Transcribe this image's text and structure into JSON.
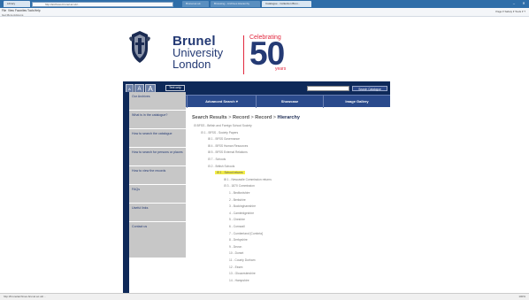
{
  "browser": {
    "tabs": [
      {
        "label": "Library",
        "active": true
      },
      {
        "label": "Brunel.ac.uk",
        "active": false
      },
      {
        "label": "Browsing - Archives Hierarchy",
        "active": false
      },
      {
        "label": "Catalogue - Collection Brun...",
        "active": false
      }
    ],
    "address": "http://archives.brunel.ac.uk/...",
    "menu": [
      "File",
      "View",
      "Favorites",
      "Tools",
      "Help"
    ],
    "favorites_bar": "Get More Add-ons",
    "command_bar": "Page ▾  Safety ▾  Tools ▾  ?"
  },
  "site": {
    "brand_word1": "Brunel",
    "brand_word2": "University",
    "brand_word3": "London",
    "celebrating": "Celebrating",
    "fifty": "50",
    "years": "years",
    "font_sizes": [
      "A",
      "A",
      "A"
    ],
    "text_only": "Text only",
    "search_button": "Search Catalogue",
    "nav": [
      "Home",
      "Advanced Search",
      "Showcase",
      "Image Gallery"
    ],
    "sidebar": [
      "Our Archives",
      "What is in the catalogue?",
      "How to search the catalogue",
      "How to search for persons or places",
      "How to view the records",
      "FAQs",
      "Useful links",
      "Contact us"
    ],
    "breadcrumb": {
      "a": "Search Results",
      "b": "Record",
      "c": "Record",
      "d": "Hierarchy",
      "sep": ">"
    },
    "tree": [
      {
        "text": "⊟ BFSS - British and Foreign School Society",
        "level": 0
      },
      {
        "text": "⊟ 1 - BFSS - Society Papers",
        "level": 1
      },
      {
        "text": "⊞ 1 - BFSS Governance",
        "level": 2
      },
      {
        "text": "⊞ 4 - BFSS Human Resources",
        "level": 2
      },
      {
        "text": "⊞ 5 - BFSS External Relations",
        "level": 2
      },
      {
        "text": "⊟ 7 - Schools",
        "level": 2
      },
      {
        "text": "⊟ 2 - British Schools",
        "level": 3
      },
      {
        "text": "⊟ 1 - School returns",
        "level": 4,
        "highlight": true
      },
      {
        "text": "⊞ 1 - Newcastle Commission returns",
        "level": 5
      },
      {
        "text": "⊟ 3 - 1870 Commission",
        "level": 5
      },
      {
        "text": "1 - Bedfordshire",
        "level": 6
      },
      {
        "text": "2 - Berkshire",
        "level": 6
      },
      {
        "text": "3 - Buckinghamshire",
        "level": 6
      },
      {
        "text": "4 - Cambridgeshire",
        "level": 6
      },
      {
        "text": "5 - Cheshire",
        "level": 6
      },
      {
        "text": "6 - Cornwall",
        "level": 6
      },
      {
        "text": "7 - Cumberland [Cumbria]",
        "level": 6
      },
      {
        "text": "8 - Derbyshire",
        "level": 6
      },
      {
        "text": "9 - Devon",
        "level": 6
      },
      {
        "text": "10 - Dorset",
        "level": 6
      },
      {
        "text": "11 - County Durham",
        "level": 6
      },
      {
        "text": "12 - Essex",
        "level": 6
      },
      {
        "text": "13 - Gloucestershire",
        "level": 6
      },
      {
        "text": "14 - Hampshire",
        "level": 6
      }
    ]
  },
  "status": {
    "url": "http://brunelarchives.brunel.ac.uk/...",
    "zoom": "100%"
  },
  "colors": {
    "navy": "#0e2959",
    "brand_blue": "#243a74",
    "accent_red": "#e2293f",
    "highlight": "#f5ef49"
  }
}
